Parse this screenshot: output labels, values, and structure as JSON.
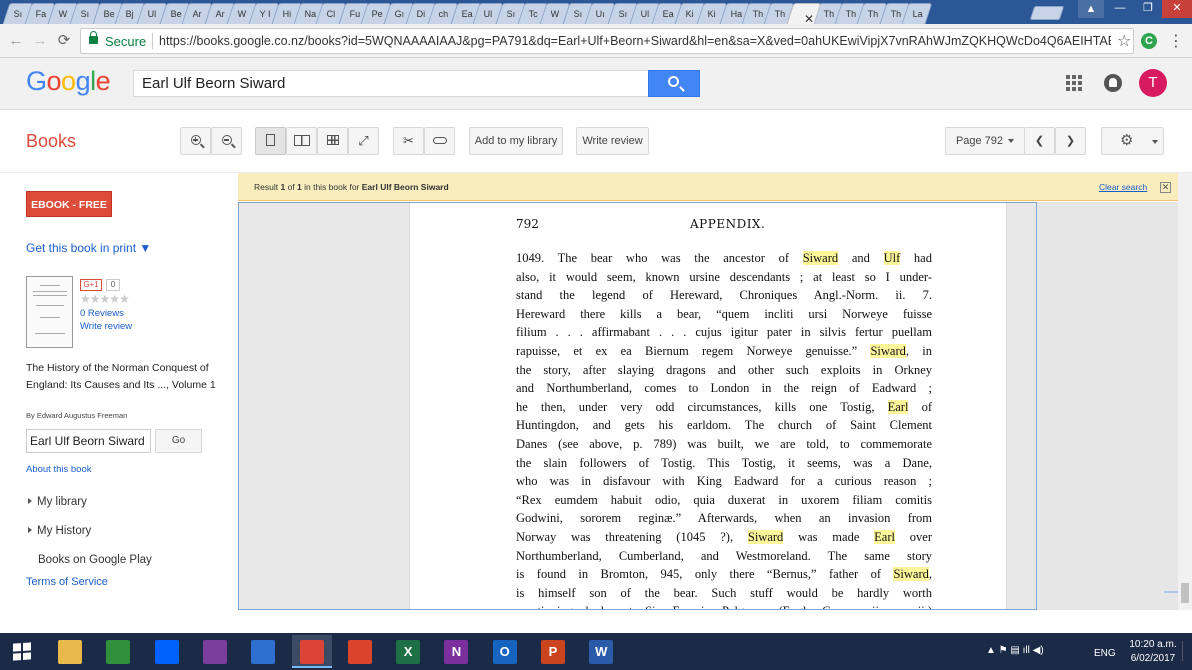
{
  "browser": {
    "tabs": [
      "Sı",
      "Fa",
      "W",
      "Sı",
      "Be",
      "Bj",
      "Ul",
      "Be",
      "Ar",
      "Ar",
      "W",
      "Y I",
      "Hi",
      "Na",
      "Cl",
      "Fu",
      "Pe",
      "Gı",
      "Di",
      "ch",
      "Ea",
      "Ul",
      "Sı",
      "Tc",
      "W",
      "Sı",
      "Uı",
      "Sı",
      "Ul",
      "Ea",
      "Ki",
      "Ki",
      "Ha",
      "Th",
      "Th",
      "",
      "Th",
      "Th",
      "Th",
      "Th",
      "La"
    ],
    "active_tab_index": 35,
    "close_glyph": "✕",
    "window_user_glyph": "▲",
    "min_glyph": "—",
    "max_glyph": "❐",
    "close_window_glyph": "✕",
    "secure_label": "Secure",
    "url": "https://books.google.co.nz/books?id=5WQNAAAAIAAJ&pg=PA791&dq=Earl+Ulf+Beorn+Siward&hl=en&sa=X&ved=0ahUKEwiVipjX7vnRAhWJmZQKHQWcDo4Q6AEIHTAB#v=",
    "ext_letter": "C"
  },
  "google": {
    "logo": [
      "G",
      "o",
      "o",
      "g",
      "l",
      "e"
    ],
    "search_value": "Earl Ulf Beorn Siward",
    "avatar_letter": "T"
  },
  "toolbar": {
    "section_title": "Books",
    "add_library_label": "Add to my library",
    "write_review_label": "Write review",
    "page_label": "Page 792",
    "prev_glyph": "❮",
    "next_glyph": "❯",
    "gear_glyph": "⚙"
  },
  "sidebar": {
    "ebook_label": "EBOOK - FREE",
    "print_link": "Get this book in print ▼",
    "gplus_label": "G+1",
    "gplus_count": "0",
    "stars": "★★★★★",
    "reviews_label": "0 Reviews",
    "write_review_label": "Write review",
    "book_title": "The History of the Norman Conquest of England: Its Causes and Its ..., Volume 1",
    "book_author": "By Edward Augustus Freeman",
    "inbook_search_value": "Earl Ulf Beorn Siward",
    "go_label": "Go",
    "about_label": "About this book",
    "my_library_label": "My library",
    "my_history_label": "My History",
    "books_play_label": "Books on Google Play",
    "terms_label": "Terms of Service"
  },
  "result_bar": {
    "prefix": "Result ",
    "index": "1",
    "mid": " of ",
    "total": "1",
    "suffix": " in this book for ",
    "query": "Earl Ulf Beorn Siward",
    "clear_label": "Clear search",
    "clear_x": "✕"
  },
  "page": {
    "number": "792",
    "heading": "APPENDIX.",
    "lines": [
      [
        {
          "t": "1049.  The bear who was the ancestor of "
        },
        {
          "t": "Siward",
          "h": true
        },
        {
          "t": " and "
        },
        {
          "t": "Ulf",
          "h": true
        },
        {
          "t": " had"
        }
      ],
      [
        {
          "t": "also, it would seem, known ursine descendants ; at least so I under-"
        }
      ],
      [
        {
          "t": "stand the legend of Hereward, Chroniques Angl.-Norm. ii. 7."
        }
      ],
      [
        {
          "t": "Hereward there kills a bear, “quem incliti ursi Norweye fuisse"
        }
      ],
      [
        {
          "t": "filium . . . affirmabant . . . cujus igitur pater in silvis fertur puellam"
        }
      ],
      [
        {
          "t": "rapuisse, et ex ea Biernum regem Norweye genuisse.”  "
        },
        {
          "t": "Siward",
          "h": true
        },
        {
          "t": ", in"
        }
      ],
      [
        {
          "t": "the story, after slaying dragons and other such exploits in Orkney"
        }
      ],
      [
        {
          "t": "and Northumberland, comes to London in the reign of Eadward ;"
        }
      ],
      [
        {
          "t": "he then, under very odd circumstances, kills one Tostig, "
        },
        {
          "t": "Earl",
          "h": true
        },
        {
          "t": " of"
        }
      ],
      [
        {
          "t": "Huntingdon, and gets his earldom.  The church of Saint Clement"
        }
      ],
      [
        {
          "t": "Danes (see above, p. 789) was built, we are told, to commemorate"
        }
      ],
      [
        {
          "t": "the slain followers of Tostig.  This Tostig, it seems, was a Dane,"
        }
      ],
      [
        {
          "t": "who was in disfavour with King Eadward for a curious reason ;"
        }
      ],
      [
        {
          "t": "“Rex eumdem habuit odio, quia duxerat in uxorem filiam comitis"
        }
      ],
      [
        {
          "t": "Godwini, sororem reginæ.”  Afterwards, when an invasion from"
        }
      ],
      [
        {
          "t": "Norway was threatening (1045 ?), "
        },
        {
          "t": "Siward",
          "h": true
        },
        {
          "t": " was made "
        },
        {
          "t": "Earl",
          "h": true
        },
        {
          "t": " over"
        }
      ],
      [
        {
          "t": "Northumberland, Cumberland, and Westmoreland.  The same story"
        }
      ],
      [
        {
          "t": "is found in Bromton, 945, only there “Bernus,” father of "
        },
        {
          "t": "Siward",
          "h": true
        },
        {
          "t": ","
        }
      ],
      [
        {
          "t": "is himself son of the bear.  Such stuff would be hardly worth"
        }
      ],
      [
        {
          "t": "mentioning had not Sir Francis Palgrave (Engl. Comm. ii. cccxii.)"
        }
      ]
    ]
  },
  "taskbar": {
    "apps": [
      {
        "name": "file-explorer",
        "color": "#e8b84a",
        "label": ""
      },
      {
        "name": "store",
        "color": "#2f8f3a",
        "label": ""
      },
      {
        "name": "dropbox",
        "color": "#0061fe",
        "label": ""
      },
      {
        "name": "paint-app",
        "color": "#7a3d9c",
        "label": ""
      },
      {
        "name": "onedrive",
        "color": "#2f6fd0",
        "label": ""
      },
      {
        "name": "chrome",
        "color": "#db4437",
        "label": "",
        "active": true
      },
      {
        "name": "power-app",
        "color": "#d9442b",
        "label": ""
      },
      {
        "name": "excel",
        "color": "#1d7044",
        "label": "X"
      },
      {
        "name": "onenote",
        "color": "#7b2e9d",
        "label": "N"
      },
      {
        "name": "outlook",
        "color": "#1664c0",
        "label": "O"
      },
      {
        "name": "powerpoint",
        "color": "#c9441f",
        "label": "P"
      },
      {
        "name": "word",
        "color": "#2a5ba8",
        "label": "W"
      }
    ],
    "tray_glyphs": "▲  ⚑  ▤  ıll  ◀)",
    "language": "ENG",
    "time": "10:20 a.m.",
    "date": "6/02/2017"
  }
}
